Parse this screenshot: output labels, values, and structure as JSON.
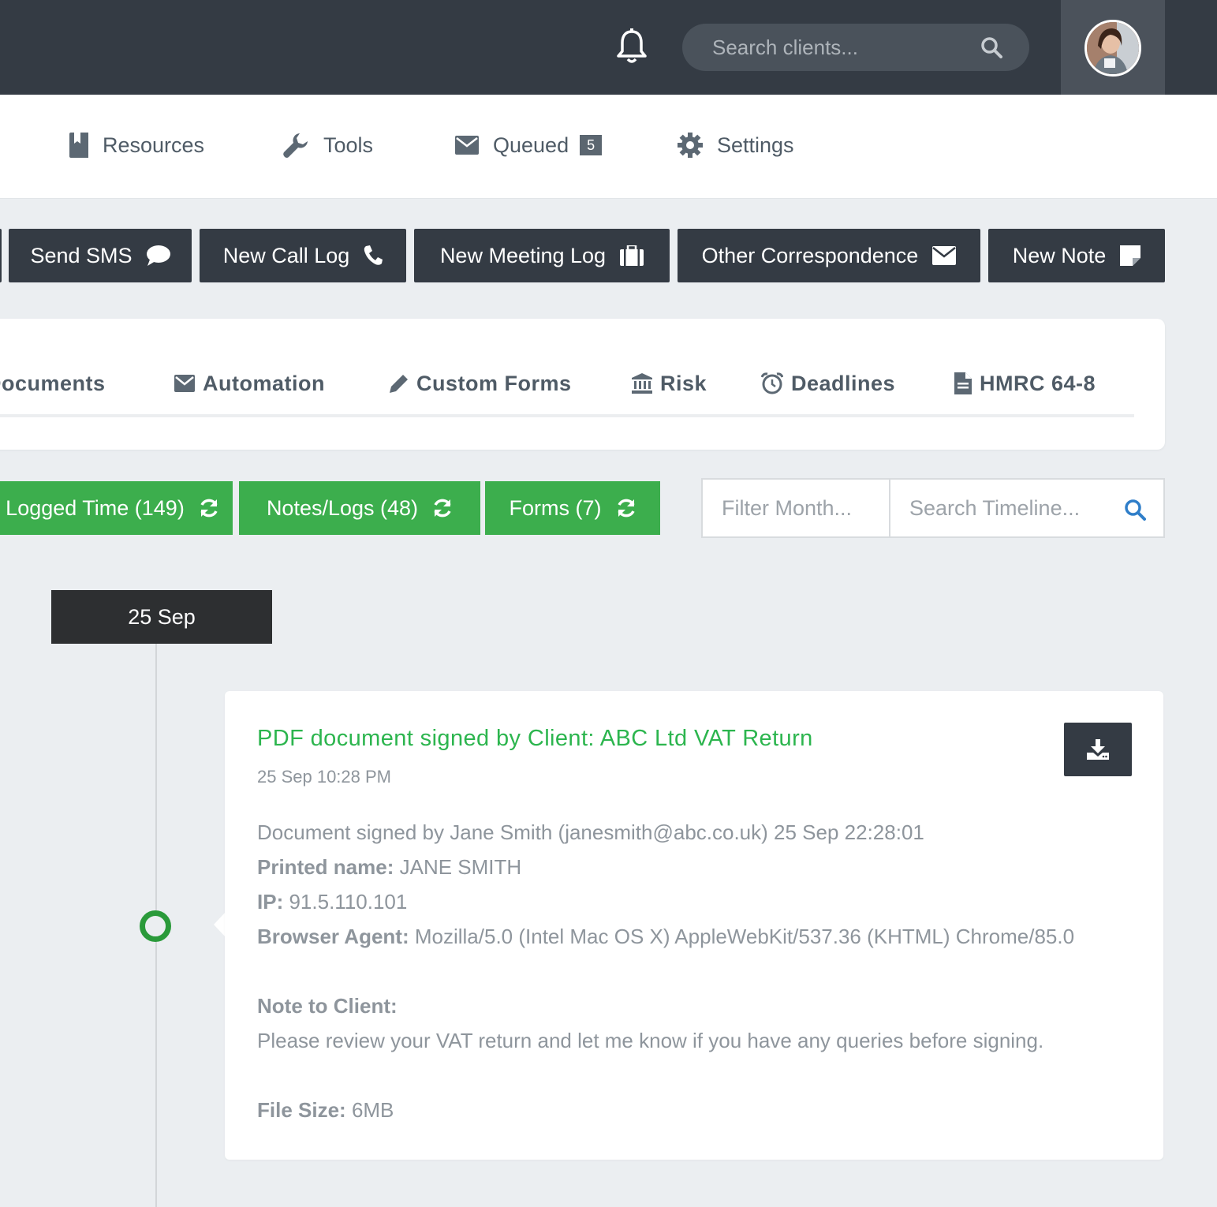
{
  "header": {
    "search_placeholder": "Search clients...",
    "icons": [
      "bell-icon",
      "search-icon",
      "avatar"
    ]
  },
  "nav": {
    "items": [
      {
        "label": "Resources",
        "icon": "book-icon"
      },
      {
        "label": "Tools",
        "icon": "wrench-icon"
      },
      {
        "label": "Queued",
        "icon": "envelope-icon",
        "badge": "5"
      },
      {
        "label": "Settings",
        "icon": "gear-icon"
      }
    ]
  },
  "actions": [
    {
      "label": "Send SMS",
      "icon": "comment-icon"
    },
    {
      "label": "New Call Log",
      "icon": "phone-icon"
    },
    {
      "label": "New Meeting Log",
      "icon": "briefcase-icon"
    },
    {
      "label": "Other Correspondence",
      "icon": "envelope-icon"
    },
    {
      "label": "New Note",
      "icon": "sticky-note-icon"
    }
  ],
  "tabs": [
    {
      "label": "Documents",
      "icon": ""
    },
    {
      "label": "Automation",
      "icon": "envelope-icon"
    },
    {
      "label": "Custom Forms",
      "icon": "pencil-icon"
    },
    {
      "label": "Risk",
      "icon": "bank-icon"
    },
    {
      "label": "Deadlines",
      "icon": "alarm-clock-icon"
    },
    {
      "label": "HMRC 64-8",
      "icon": "file-icon"
    }
  ],
  "filters": [
    {
      "label": "Logged Time (149)",
      "icon": "refresh-icon"
    },
    {
      "label": "Notes/Logs (48)",
      "icon": "refresh-icon"
    },
    {
      "label": "Forms (7)",
      "icon": "refresh-icon"
    }
  ],
  "filter_inputs": {
    "month_placeholder": "Filter Month...",
    "timeline_placeholder": "Search Timeline..."
  },
  "timeline": {
    "date_label": "25 Sep",
    "entry": {
      "title": "PDF document signed by Client: ABC Ltd VAT Return",
      "timestamp": "25 Sep 10:28 PM",
      "signed_line": "Document signed by Jane Smith (janesmith@abc.co.uk) 25 Sep 22:28:01",
      "printed_name_label": "Printed name:",
      "printed_name": "JANE SMITH",
      "ip_label": "IP:",
      "ip": "91.5.110.101",
      "browser_label": "Browser Agent:",
      "browser": "Mozilla/5.0 (Intel Mac OS X) AppleWebKit/537.36 (KHTML) Chrome/85.0",
      "note_label": "Note to Client:",
      "note": "Please review your VAT return and let me know if you have any queries before signing.",
      "filesize_label": "File Size:",
      "filesize": "6MB"
    }
  },
  "colors": {
    "topbar": "#343b44",
    "accent_green": "#3cae4d",
    "title_green": "#2cb54e",
    "dark_button": "#343b44"
  }
}
